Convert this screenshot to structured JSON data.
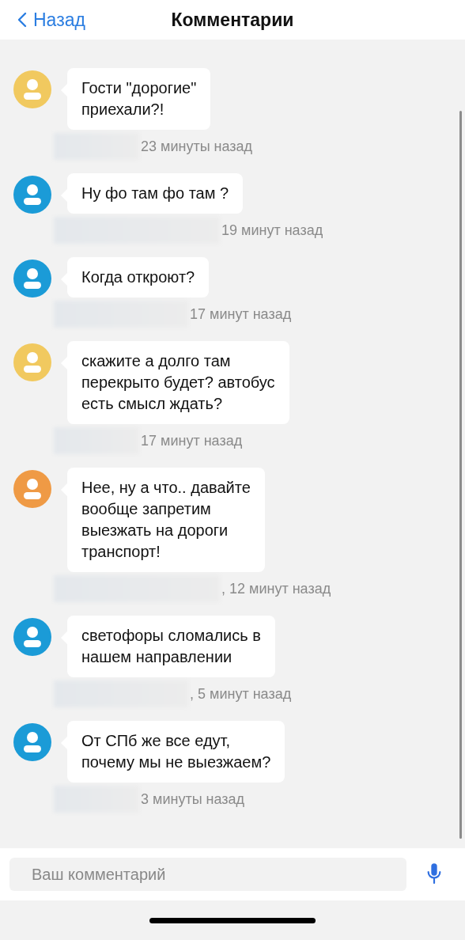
{
  "header": {
    "back": "Назад",
    "title": "Комментарии"
  },
  "comments": [
    {
      "color": "#f1c95f",
      "text": "Гости \"дорогие\"\nприехали?!",
      "time": "23 минуты назад"
    },
    {
      "color": "#1b9bd7",
      "text": "Ну фо там фо там ?",
      "time": "19 минут назад"
    },
    {
      "color": "#1b9bd7",
      "text": "Когда откроют?",
      "time": "17 минут назад"
    },
    {
      "color": "#f1c95f",
      "text": "скажите а долго там\nперекрыто будет? автобус\nесть смысл ждать?",
      "time": "17 минут назад"
    },
    {
      "color": "#ef9a45",
      "text": "Нее, ну а что.. давайте\nвообще запретим\nвыезжать на дороги\nтранспорт!",
      "time": ", 12 минут назад"
    },
    {
      "color": "#1b9bd7",
      "text": "светофоры сломались в\nнашем направлении",
      "time": ", 5 минут назад"
    },
    {
      "color": "#1b9bd7",
      "text": "От СПб же все едут,\nпочему мы не выезжаем?",
      "time": "3 минуты назад"
    }
  ],
  "input": {
    "placeholder": "Ваш комментарий"
  }
}
